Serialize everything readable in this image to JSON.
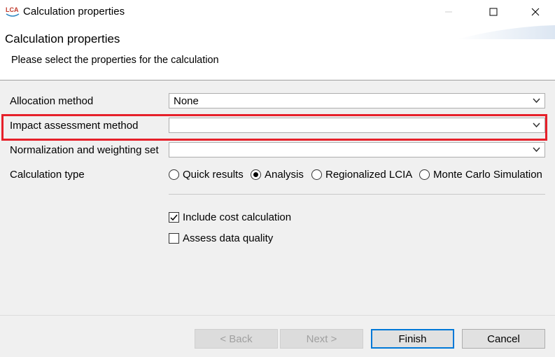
{
  "window": {
    "title": "Calculation properties",
    "app_icon_text": "LCA"
  },
  "header": {
    "title": "Calculation properties",
    "description": "Please select the properties for the calculation"
  },
  "form": {
    "allocation": {
      "label": "Allocation method",
      "value": "None"
    },
    "impact": {
      "label": "Impact assessment method",
      "value": ""
    },
    "normalization": {
      "label": "Normalization and weighting set",
      "value": ""
    },
    "calc_type": {
      "label": "Calculation type",
      "options": [
        {
          "label": "Quick results",
          "checked": false
        },
        {
          "label": "Analysis",
          "checked": true
        },
        {
          "label": "Regionalized LCIA",
          "checked": false
        },
        {
          "label": "Monte Carlo Simulation",
          "checked": false
        }
      ]
    },
    "cost": {
      "label": "Include cost calculation",
      "checked": true
    },
    "quality": {
      "label": "Assess data quality",
      "checked": false
    }
  },
  "buttons": {
    "back": "< Back",
    "next": "Next >",
    "finish": "Finish",
    "cancel": "Cancel"
  },
  "colors": {
    "highlight": "#e6202a",
    "default_button_border": "#0078d7"
  }
}
